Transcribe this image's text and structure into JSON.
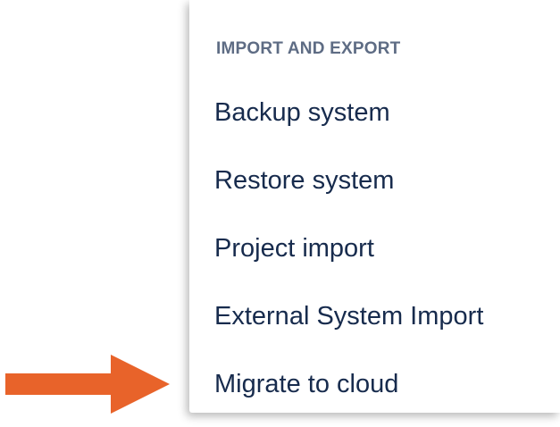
{
  "menu": {
    "section_title": "IMPORT AND EXPORT",
    "items": [
      {
        "label": "Backup system"
      },
      {
        "label": "Restore system"
      },
      {
        "label": "Project import"
      },
      {
        "label": "External System Import"
      },
      {
        "label": "Migrate to cloud"
      }
    ]
  },
  "annotation": {
    "arrow_color": "#e8632a",
    "points_to": "Migrate to cloud"
  }
}
